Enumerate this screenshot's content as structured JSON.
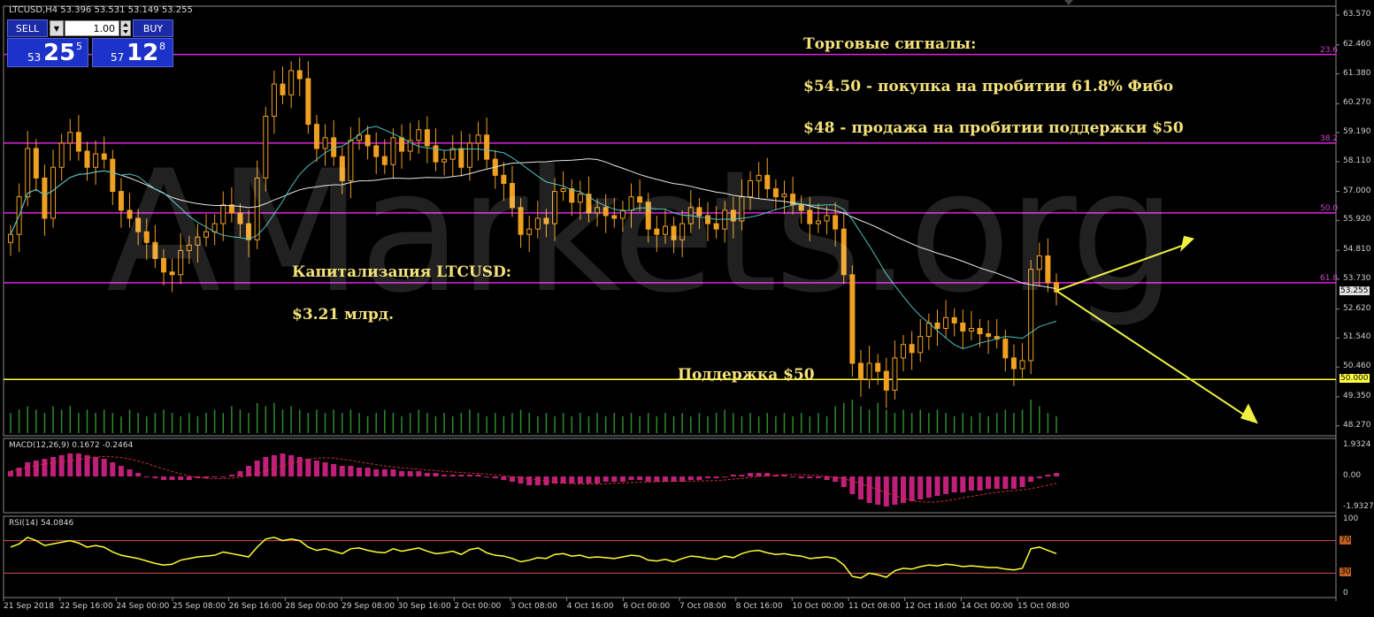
{
  "header": {
    "symbol_info": "LTCUSD,H4  53.396 53.531 53.149 53.255"
  },
  "trade_panel": {
    "sell_label": "SELL",
    "buy_label": "BUY",
    "lot_value": "1.00",
    "sell_prefix": "53",
    "sell_big": "25",
    "sell_sup": "5",
    "buy_prefix": "57",
    "buy_big": "12",
    "buy_sup": "8"
  },
  "watermark": "AMarkets.org",
  "annotations": {
    "signals_title": "Торговые сигналы:",
    "signal_buy": "$54.50 - покупка на пробитии 61.8% Фибо",
    "signal_sell": "$48 - продажа на пробитии поддержки $50",
    "cap_title": "Капитализация LTCUSD:",
    "cap_value": "$3.21 млрд.",
    "support_label": "Поддержка $50"
  },
  "indicators": {
    "macd_label": "MACD(12,26,9) 0.1672 -0.2464",
    "rsi_label": "RSI(14) 54.0846"
  },
  "colors": {
    "bull_candle": "#f0a020",
    "bear_candle": "#f0a020",
    "fib_line": "#e020e0",
    "support_line": "#ffff40",
    "ma_slow": "#e8e8e8",
    "ma_fast": "#4fc0c0",
    "volume": "#2e8b2e",
    "macd_hist": "#c0207a",
    "macd_signal": "#d03030",
    "rsi_line": "#ffff30",
    "rsi_levels": "#d05050",
    "arrow": "#f0f040"
  },
  "chart_data": {
    "type": "candlestick",
    "symbol": "LTCUSD",
    "timeframe": "H4",
    "ohlc_header": {
      "open": 53.396,
      "high": 53.531,
      "low": 53.149,
      "close": 53.255
    },
    "price_ticks": [
      "63.570",
      "62.460",
      "61.380",
      "60.270",
      "59.190",
      "58.110",
      "57.000",
      "55.920",
      "54.810",
      "53.730",
      "52.620",
      "51.540",
      "50.460",
      "49.350",
      "48.270"
    ],
    "current_price": "53.255",
    "support_price": "50.000",
    "fib_levels": [
      {
        "label": "23.6",
        "price": 62.1
      },
      {
        "label": "38.2",
        "price": 58.8
      },
      {
        "label": "50.0",
        "price": 56.2
      },
      {
        "label": "61.8",
        "price": 53.6
      }
    ],
    "x_labels": [
      "21 Sep 2018",
      "22 Sep 16:00",
      "24 Sep 00:00",
      "25 Sep 08:00",
      "26 Sep 16:00",
      "28 Sep 00:00",
      "29 Sep 08:00",
      "30 Sep 16:00",
      "2 Oct 00:00",
      "3 Oct 08:00",
      "4 Oct 16:00",
      "6 Oct 00:00",
      "7 Oct 08:00",
      "8 Oct 16:00",
      "10 Oct 00:00",
      "11 Oct 08:00",
      "12 Oct 16:00",
      "14 Oct 00:00",
      "15 Oct 08:00"
    ],
    "closes": [
      55.4,
      56.8,
      58.6,
      57.5,
      56.0,
      57.9,
      58.8,
      59.2,
      58.5,
      57.9,
      58.4,
      58.2,
      57.0,
      56.3,
      56.0,
      55.5,
      55.1,
      54.5,
      54.0,
      53.9,
      54.8,
      55.0,
      55.3,
      55.5,
      55.8,
      56.5,
      56.2,
      55.8,
      55.2,
      57.5,
      59.8,
      61.0,
      60.6,
      61.5,
      61.2,
      59.5,
      58.6,
      59.0,
      58.3,
      57.4,
      58.9,
      59.1,
      58.7,
      58.3,
      58.0,
      59.0,
      58.5,
      58.9,
      59.3,
      58.7,
      58.1,
      58.2,
      58.6,
      57.9,
      58.8,
      59.1,
      58.2,
      57.6,
      57.3,
      56.4,
      55.4,
      55.6,
      56.0,
      55.8,
      57.0,
      57.1,
      56.6,
      56.9,
      56.2,
      56.4,
      56.1,
      56.0,
      56.3,
      56.8,
      56.6,
      55.6,
      55.4,
      55.7,
      55.2,
      55.8,
      56.4,
      56.1,
      55.8,
      55.6,
      56.3,
      55.9,
      56.8,
      57.4,
      57.6,
      57.1,
      56.8,
      56.9,
      56.5,
      56.3,
      55.8,
      55.9,
      56.1,
      55.6,
      53.9,
      50.6,
      50.0,
      50.6,
      50.3,
      49.6,
      50.8,
      51.3,
      51.0,
      51.6,
      52.1,
      51.9,
      52.3,
      52.1,
      51.8,
      51.9,
      51.7,
      51.6,
      51.5,
      50.8,
      50.4,
      50.7,
      54.1,
      54.6,
      53.6,
      53.255
    ],
    "volume_rel": [
      0.6,
      0.7,
      0.8,
      0.7,
      0.6,
      0.8,
      0.7,
      0.8,
      0.6,
      0.7,
      0.6,
      0.7,
      0.6,
      0.5,
      0.7,
      0.6,
      0.5,
      0.6,
      0.7,
      0.6,
      0.5,
      0.6,
      0.5,
      0.6,
      0.7,
      0.6,
      0.8,
      0.7,
      0.6,
      0.9,
      0.8,
      0.9,
      0.7,
      0.8,
      0.7,
      0.6,
      0.7,
      0.6,
      0.7,
      0.6,
      0.7,
      0.6,
      0.5,
      0.6,
      0.7,
      0.6,
      0.5,
      0.6,
      0.7,
      0.6,
      0.5,
      0.6,
      0.5,
      0.6,
      0.7,
      0.6,
      0.5,
      0.6,
      0.5,
      0.6,
      0.7,
      0.6,
      0.5,
      0.6,
      0.5,
      0.6,
      0.5,
      0.6,
      0.5,
      0.6,
      0.5,
      0.6,
      0.5,
      0.6,
      0.5,
      0.6,
      0.5,
      0.6,
      0.5,
      0.6,
      0.5,
      0.6,
      0.5,
      0.6,
      0.7,
      0.6,
      0.5,
      0.6,
      0.5,
      0.6,
      0.5,
      0.6,
      0.5,
      0.6,
      0.5,
      0.6,
      0.5,
      0.8,
      0.9,
      1.0,
      0.8,
      0.7,
      0.9,
      0.7,
      0.6,
      0.7,
      0.6,
      0.7,
      0.6,
      0.7,
      0.6,
      0.5,
      0.6,
      0.5,
      0.6,
      0.5,
      0.6,
      0.7,
      0.6,
      0.7,
      1.0,
      0.8,
      0.6,
      0.5
    ],
    "macd_hist": [
      0.3,
      0.5,
      0.8,
      0.9,
      1.0,
      1.1,
      1.2,
      1.3,
      1.3,
      1.2,
      1.1,
      1.0,
      0.8,
      0.6,
      0.4,
      0.2,
      0.0,
      -0.1,
      -0.2,
      -0.2,
      -0.2,
      -0.2,
      -0.1,
      -0.1,
      0.0,
      0.0,
      0.1,
      0.3,
      0.6,
      0.9,
      1.1,
      1.2,
      1.3,
      1.2,
      1.1,
      1.0,
      0.9,
      0.8,
      0.7,
      0.6,
      0.6,
      0.5,
      0.5,
      0.4,
      0.4,
      0.4,
      0.3,
      0.3,
      0.3,
      0.2,
      0.2,
      0.1,
      0.1,
      0.1,
      0.1,
      0.1,
      0.0,
      -0.1,
      -0.2,
      -0.3,
      -0.4,
      -0.5,
      -0.5,
      -0.5,
      -0.4,
      -0.4,
      -0.4,
      -0.4,
      -0.4,
      -0.4,
      -0.3,
      -0.3,
      -0.3,
      -0.2,
      -0.2,
      -0.3,
      -0.3,
      -0.3,
      -0.3,
      -0.3,
      -0.2,
      -0.2,
      -0.1,
      -0.1,
      0.0,
      0.1,
      0.1,
      0.2,
      0.2,
      0.2,
      0.1,
      0.1,
      0.0,
      -0.1,
      -0.1,
      -0.1,
      -0.2,
      -0.3,
      -0.6,
      -1.0,
      -1.3,
      -1.5,
      -1.6,
      -1.7,
      -1.6,
      -1.5,
      -1.4,
      -1.3,
      -1.2,
      -1.1,
      -1.0,
      -0.9,
      -0.9,
      -0.8,
      -0.8,
      -0.7,
      -0.7,
      -0.7,
      -0.7,
      -0.6,
      -0.3,
      -0.1,
      0.1,
      0.2
    ],
    "macd_ticks": [
      "1.9324",
      "0.00",
      "-1.9327"
    ],
    "rsi_values": [
      62,
      66,
      74,
      70,
      64,
      66,
      68,
      70,
      67,
      62,
      64,
      62,
      56,
      52,
      50,
      48,
      45,
      42,
      40,
      41,
      46,
      48,
      50,
      51,
      52,
      56,
      54,
      52,
      50,
      62,
      72,
      74,
      70,
      72,
      70,
      62,
      58,
      60,
      57,
      54,
      60,
      61,
      58,
      56,
      55,
      60,
      57,
      59,
      61,
      57,
      54,
      55,
      57,
      53,
      59,
      61,
      55,
      52,
      51,
      48,
      44,
      46,
      49,
      48,
      53,
      54,
      51,
      52,
      49,
      50,
      49,
      48,
      50,
      52,
      51,
      46,
      45,
      47,
      44,
      48,
      51,
      50,
      48,
      47,
      51,
      49,
      54,
      57,
      58,
      55,
      53,
      54,
      52,
      51,
      48,
      49,
      50,
      48,
      40,
      26,
      24,
      30,
      28,
      25,
      33,
      36,
      35,
      38,
      40,
      39,
      41,
      40,
      38,
      39,
      38,
      37,
      37,
      35,
      34,
      36,
      60,
      62,
      58,
      54
    ],
    "rsi_ticks": [
      "100",
      "70",
      "30",
      "0"
    ]
  }
}
